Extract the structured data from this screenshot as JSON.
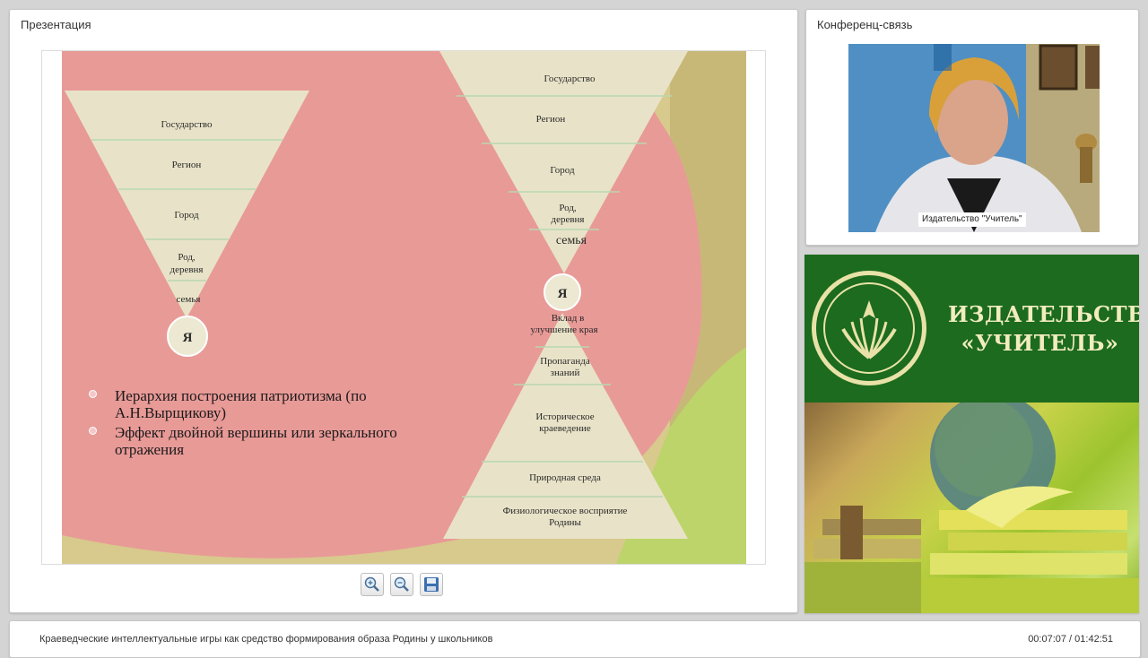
{
  "presentation": {
    "title": "Презентация",
    "slide": {
      "left_pyramid": [
        "Государство",
        "Регион",
        "Город",
        "Род, деревня",
        "семья"
      ],
      "ya": "Я",
      "right_top_pyramid": [
        "Государство",
        "Регион",
        "Город",
        "Род, деревня",
        "семья"
      ],
      "right_bottom_pyramid": [
        "Вклад в улучшение края",
        "Пропаганда знаний",
        "Историческое краеведение",
        "Природная среда",
        "Физиологическое восприятие Родины"
      ],
      "bullets": [
        "Иерархия построения патриотизма (по А.Н.Вырщикову)",
        "Эффект двойной вершины или зеркального отражения"
      ]
    },
    "toolbar": {
      "zoom_in": "zoom-in-icon",
      "zoom_out": "zoom-out-icon",
      "save": "save-icon"
    }
  },
  "conference": {
    "title": "Конференц-связь",
    "caption": "Издательство \"Учитель\""
  },
  "logo": {
    "line1": "ИЗДАТЕЛЬСТВО",
    "line2": "«УЧИТЕЛЬ»"
  },
  "bottom": {
    "title": "Краеведческие интеллектуальные игры как средство формирования образа Родины у школьников",
    "time": "00:07:07 / 01:42:51"
  },
  "colors": {
    "slide_pink": "#e89a97",
    "slide_cream": "#e8e3c8",
    "slide_tan": "#cdbb80",
    "slide_green": "#bcd46a",
    "logo_green": "#1c6b1e",
    "logo_gold": "#f2ecc0"
  }
}
